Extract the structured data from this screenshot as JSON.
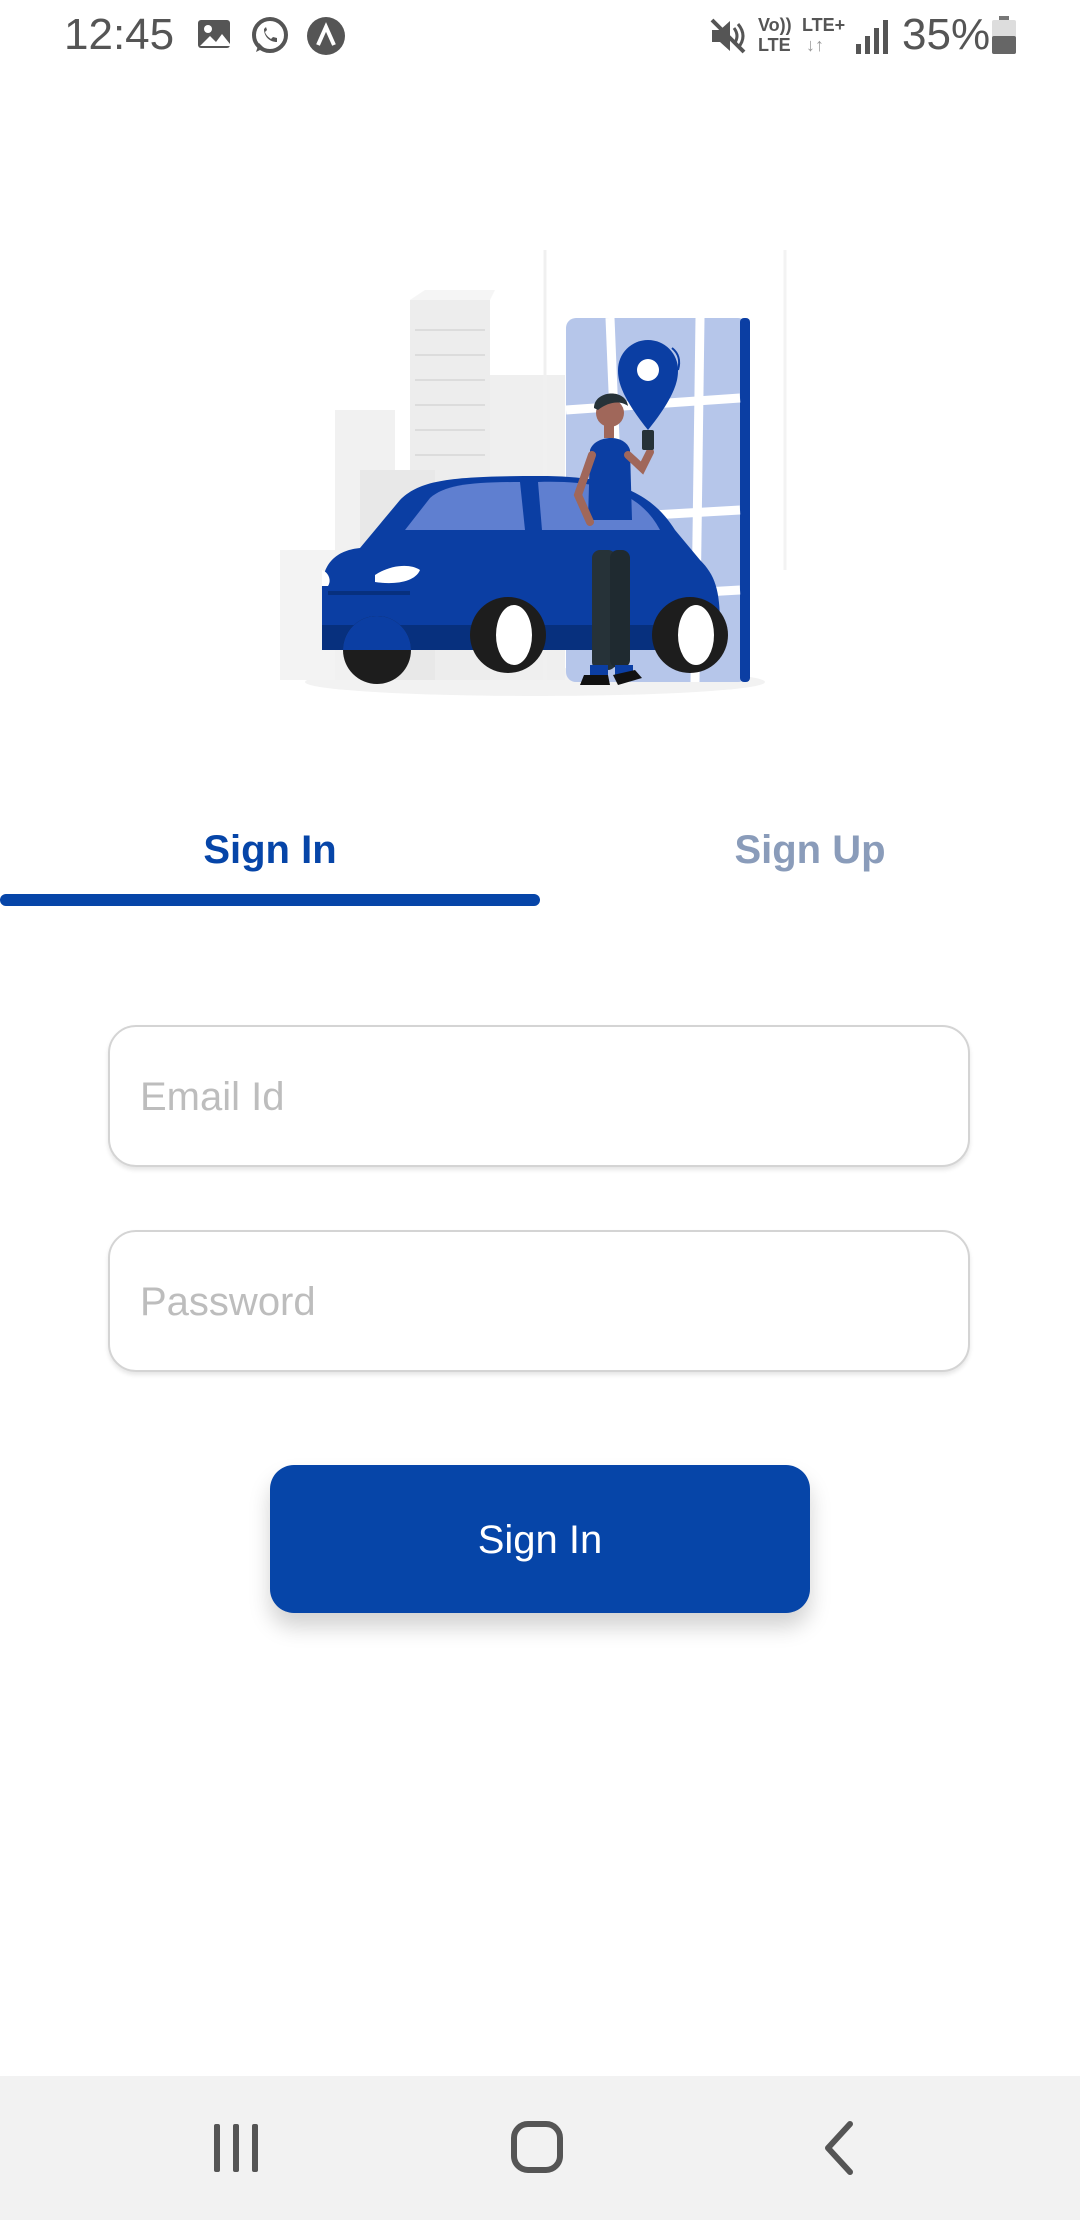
{
  "status_bar": {
    "time": "12:45",
    "left_icons": [
      "gallery-icon",
      "whatsapp-icon",
      "app-icon"
    ],
    "right_icons": [
      "mute-icon",
      "volte-icon",
      "lte-plus-icon",
      "signal-icon",
      "battery-icon"
    ],
    "volte_label_top": "Vo))",
    "volte_label_bottom": "LTE",
    "lte_label": "LTE+",
    "battery": "35%"
  },
  "tabs": [
    {
      "label": "Sign In",
      "active": true
    },
    {
      "label": "Sign Up",
      "active": false
    }
  ],
  "form": {
    "email_placeholder": "Email Id",
    "password_placeholder": "Password",
    "submit_label": "Sign In"
  },
  "nav_bar": {
    "buttons": [
      "recents-icon",
      "home-icon",
      "back-icon"
    ]
  },
  "colors": {
    "accent": "#0645a8",
    "inactive_tab": "#8a9cba",
    "placeholder": "#bdbdbd",
    "nav_bg": "#f2f2f2"
  }
}
